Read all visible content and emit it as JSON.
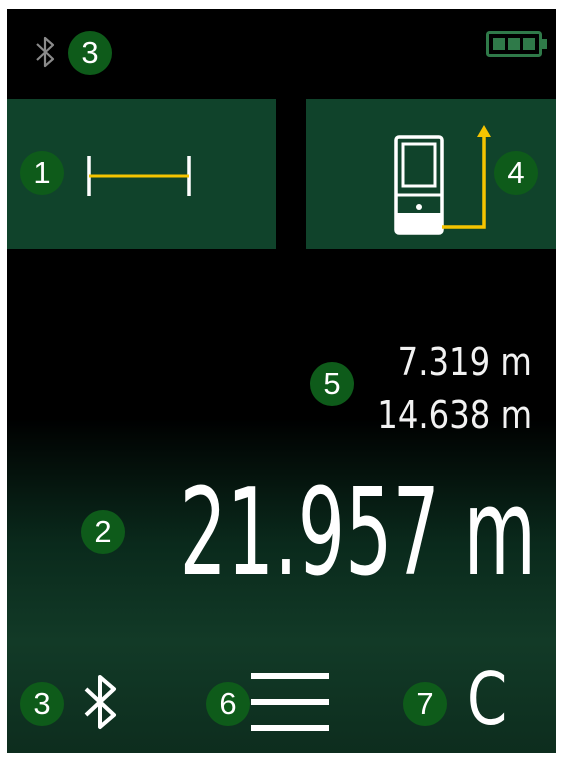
{
  "status_bar": {
    "bluetooth_icon": "bluetooth-icon",
    "bluetooth_badge": "3",
    "battery_icon": "battery-full-icon"
  },
  "tiles": {
    "distance_mode_badge": "1",
    "distance_mode_icon": "distance-line-icon",
    "reference_badge": "4",
    "reference_icon": "device-reference-icon"
  },
  "measurements": {
    "badge_small": "5",
    "value_1": "7.319 m",
    "value_2": "14.638 m",
    "badge_main": "2",
    "main_value": "21.957 m"
  },
  "bottom_bar": {
    "bluetooth_badge": "3",
    "bluetooth_icon": "bluetooth-icon",
    "menu_badge": "6",
    "menu_icon": "menu-icon",
    "clear_badge": "7",
    "clear_label": "C"
  },
  "colors": {
    "badge": "#0e5b1a",
    "tile": "#10432b",
    "accent_yellow": "#f5c400",
    "battery": "#2f7a49"
  }
}
